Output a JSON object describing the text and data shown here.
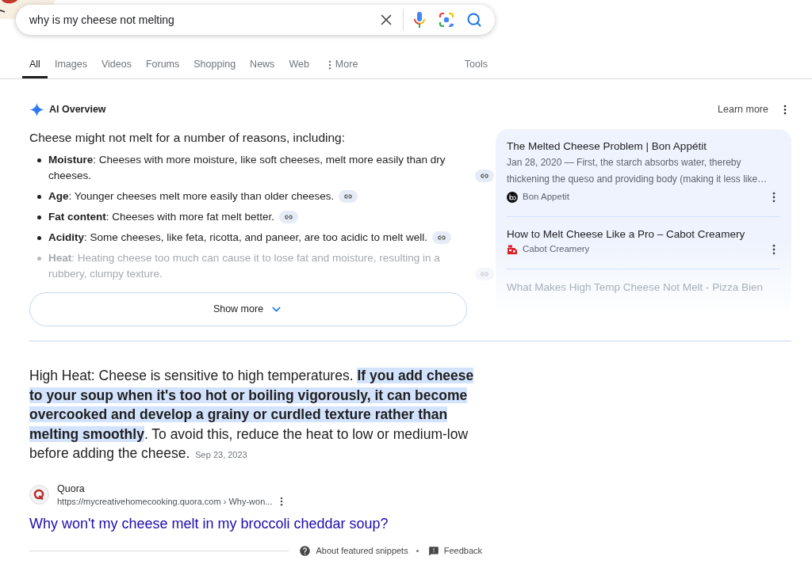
{
  "search": {
    "value": "why is my cheese not melting"
  },
  "tabs": [
    {
      "label": "All",
      "selected": true,
      "kind": "plain"
    },
    {
      "label": "Images",
      "selected": false,
      "kind": "plain"
    },
    {
      "label": "Videos",
      "selected": false,
      "kind": "plain"
    },
    {
      "label": "Forums",
      "selected": false,
      "kind": "plain"
    },
    {
      "label": "Shopping",
      "selected": false,
      "kind": "plain"
    },
    {
      "label": "News",
      "selected": false,
      "kind": "plain"
    },
    {
      "label": "Web",
      "selected": false,
      "kind": "plain"
    },
    {
      "label": "More",
      "selected": false,
      "kind": "menu"
    }
  ],
  "tools": {
    "label": "Tools"
  },
  "ai_overview": {
    "title": "AI Overview",
    "learn_more": "Learn more",
    "intro": "Cheese might not melt for a number of reasons, including:",
    "items": [
      {
        "text": "**Moisture**: Cheeses with more moisture, like soft cheeses, melt more easily than dry cheeses.",
        "faded": false
      },
      {
        "text": "**Age**: Younger cheeses melt more easily than older cheeses.",
        "faded": false
      },
      {
        "text": "**Fat content**: Cheeses with more fat melt better.",
        "faded": false
      },
      {
        "text": "**Acidity**: Some cheeses, like feta, ricotta, and paneer, are too acidic to melt well.",
        "faded": false
      },
      {
        "text": "**Heat**: Heating cheese too much can cause it to lose fat and moisture, resulting in a rubbery, clumpy texture.",
        "faded": true
      }
    ],
    "show_more": "Show more",
    "sources": [
      {
        "kind": "disc",
        "title": "The Melted Cheese Problem | Bon Appétit",
        "snippet": "Jan 28, 2020 — First, the starch absorbs water, thereby thickening the queso and providing body (making it less like…",
        "site": "Bon Appetit",
        "color": "#111111",
        "faded": false
      },
      {
        "kind": "tag",
        "title": "How to Melt Cheese Like a Pro – Cabot Creamery",
        "site": "Cabot Creamery",
        "color": "#d9232d",
        "faded": false
      },
      {
        "kind": "plain",
        "title": "What Makes High Temp Cheese Not Melt - Pizza Bien",
        "faded": true
      }
    ]
  },
  "featured_snippet": {
    "parts": [
      {
        "text": "High Heat: Cheese is sensitive to high temperatures. ",
        "highlighted": false
      },
      {
        "text": "If you add cheese to your soup when it's too hot or boiling vigorously, it can become overcooked and develop a grainy or curdled texture rather than melting smoothly",
        "highlighted": true
      },
      {
        "text": ". To avoid this, reduce the heat to low or medium-low before adding the cheese.",
        "highlighted": false
      }
    ],
    "date": "Sep 23, 2023",
    "source": {
      "name": "Quora",
      "url": "https://mycreativehomecooking.quora.com › Why-won..."
    },
    "title": "Why won't my cheese melt in my broccoli cheddar soup?",
    "footer": {
      "about": "About featured snippets",
      "feedback": "Feedback"
    }
  }
}
